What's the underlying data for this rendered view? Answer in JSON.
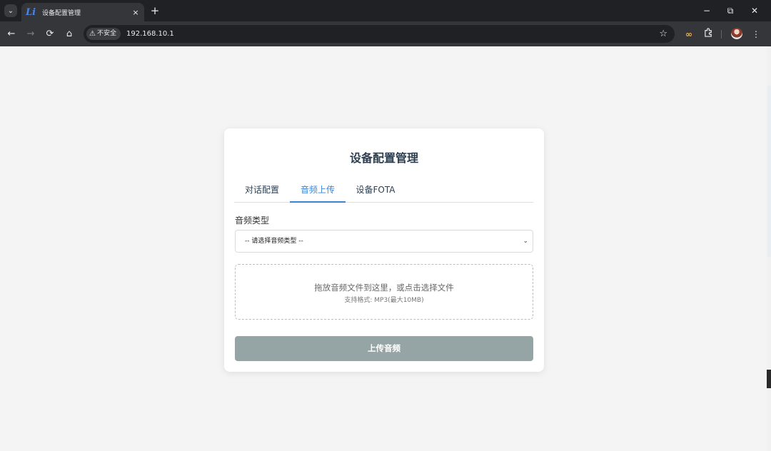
{
  "browser": {
    "tab": {
      "title": "设备配置管理",
      "favicon": "Li",
      "close": "×"
    },
    "new_tab": "+",
    "window_controls": {
      "minimize": "−",
      "restore": "⧉",
      "close": "✕"
    },
    "nav": {
      "back": "←",
      "forward": "→",
      "reload": "⟳",
      "home": "⌂"
    },
    "omnibox": {
      "security_label": "不安全",
      "url": "192.168.10.1"
    },
    "icons": [
      "tab-search-icon",
      "star-icon",
      "extension-infinity-icon",
      "extensions-puzzle-icon",
      "profile-avatar",
      "more-menu-icon"
    ]
  },
  "page": {
    "title": "设备配置管理",
    "tabs": [
      {
        "label": "对话配置",
        "active": false
      },
      {
        "label": "音频上传",
        "active": true
      },
      {
        "label": "设备FOTA",
        "active": false
      }
    ],
    "audio_type": {
      "label": "音频类型",
      "selected": "-- 请选择音频类型 --"
    },
    "dropzone": {
      "main_text": "拖放音频文件到这里，或点击选择文件",
      "sub_text": "支持格式: MP3(最大10MB)"
    },
    "upload_button": {
      "label": "上传音频",
      "color": "#95a5a6"
    },
    "accent_color": "#3c85d6"
  }
}
